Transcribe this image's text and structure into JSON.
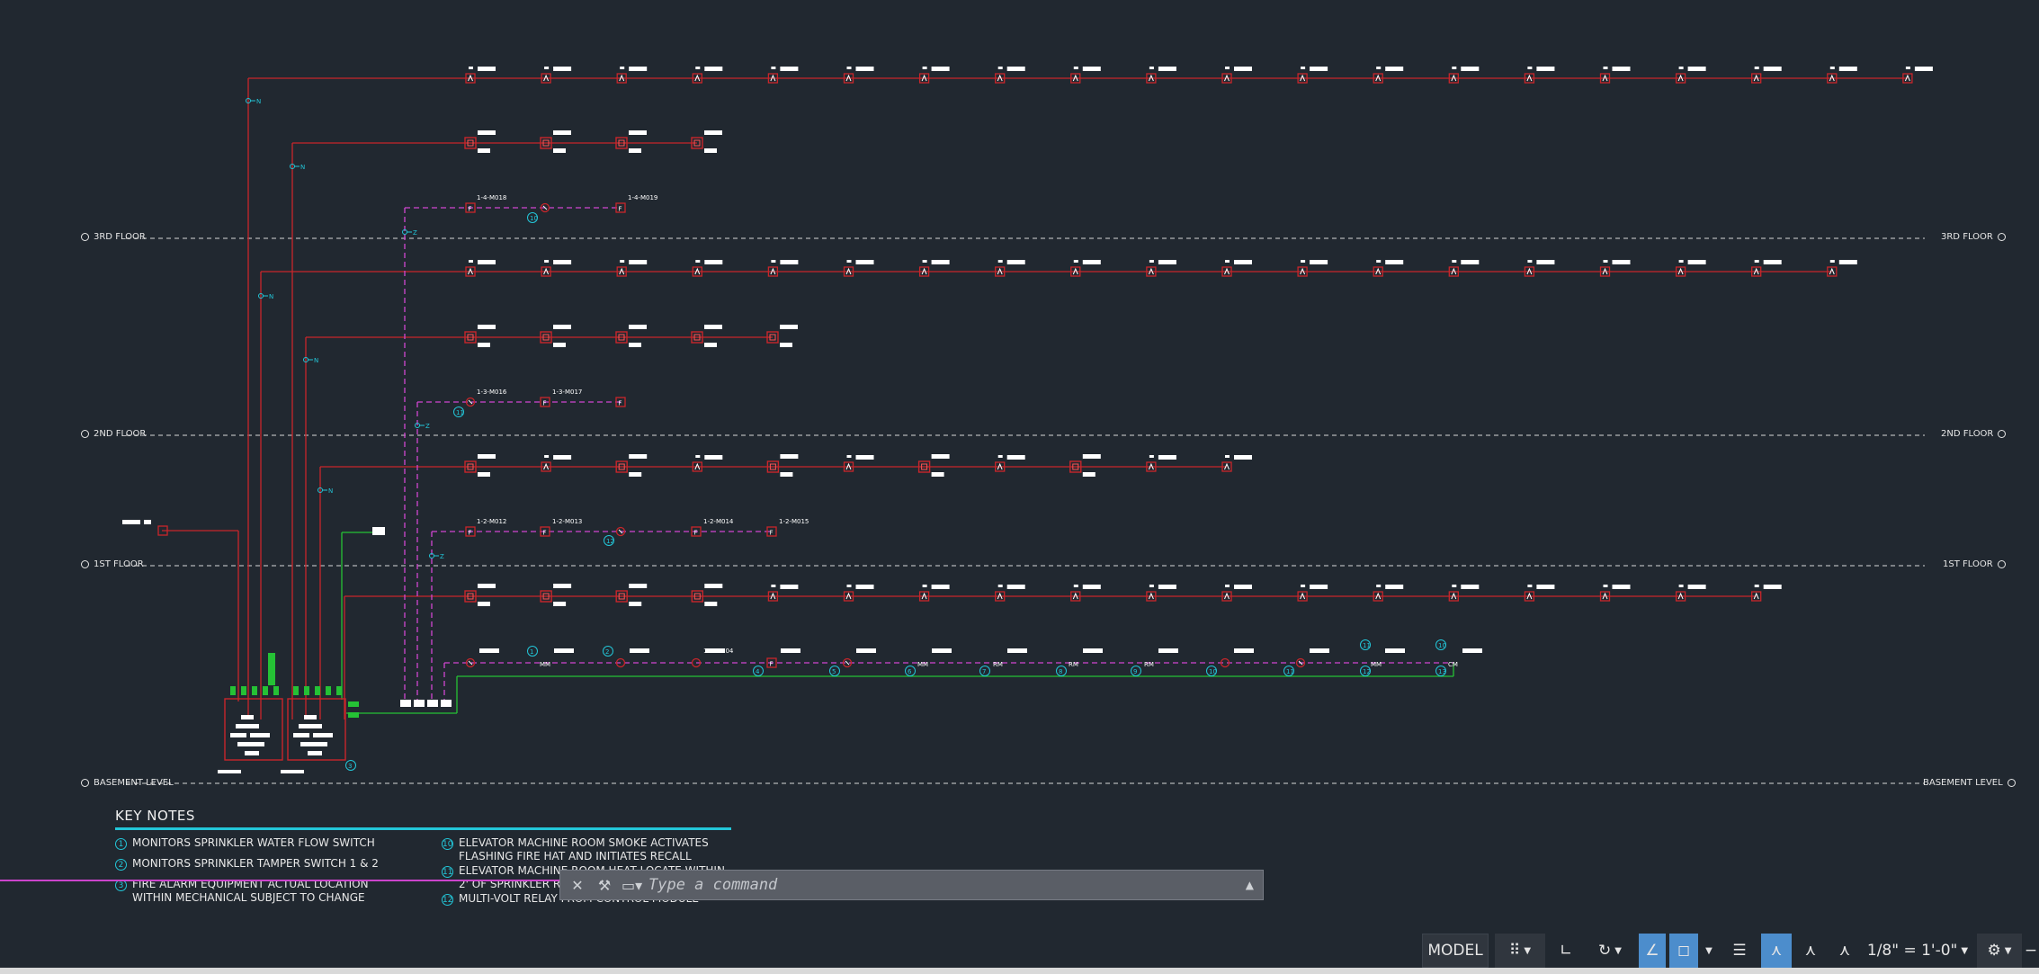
{
  "floors": [
    {
      "label": "3RD FLOOR"
    },
    {
      "label": "2ND FLOOR"
    },
    {
      "label": "1ST FLOOR"
    },
    {
      "label": "BASEMENT LEVEL"
    }
  ],
  "module_tags": [
    "1-4-M018",
    "1-4-M019",
    "1-3-M016",
    "1-3-M017",
    "1-2-M012",
    "1-2-M013",
    "1-2-M014",
    "1-2-M015",
    "1-1-M004"
  ],
  "device_codes": [
    "MM",
    "RM",
    "CM"
  ],
  "key_notes": {
    "title": "KEY NOTES",
    "items": [
      {
        "num": "1",
        "text": "MONITORS SPRINKLER WATER FLOW SWITCH"
      },
      {
        "num": "2",
        "text": "MONITORS SPRINKLER TAMPER SWITCH 1 & 2"
      },
      {
        "num": "3",
        "text": "FIRE ALARM EQUIPMENT ACTUAL LOCATION WITHIN MECHANICAL SUBJECT TO CHANGE"
      },
      {
        "num": "10",
        "text": "ELEVATOR MACHINE ROOM SMOKE ACTIVATES FLASHING FIRE HAT AND INITIATES RECALL"
      },
      {
        "num": "11",
        "text": "ELEVATOR MACHINE ROOM HEAT LOCATE WITHIN 2' OF SPRINKLER ROOM ACTIVATES SHUNT"
      },
      {
        "num": "12",
        "text": "MULTI-VOLT RELAY FROM CONTROL MODULE"
      }
    ]
  },
  "command_line": {
    "placeholder": "Type a command"
  },
  "status_bar": {
    "model_label": "MODEL",
    "scale_label": "1/8\" = 1'-0\""
  },
  "colors": {
    "background": "#212830",
    "circuit_red": "#c8262b",
    "dashed_magenta": "#d046d0",
    "green_line": "#25c135",
    "cyan": "#23c6d8",
    "active_blue": "#4c8dcc"
  }
}
